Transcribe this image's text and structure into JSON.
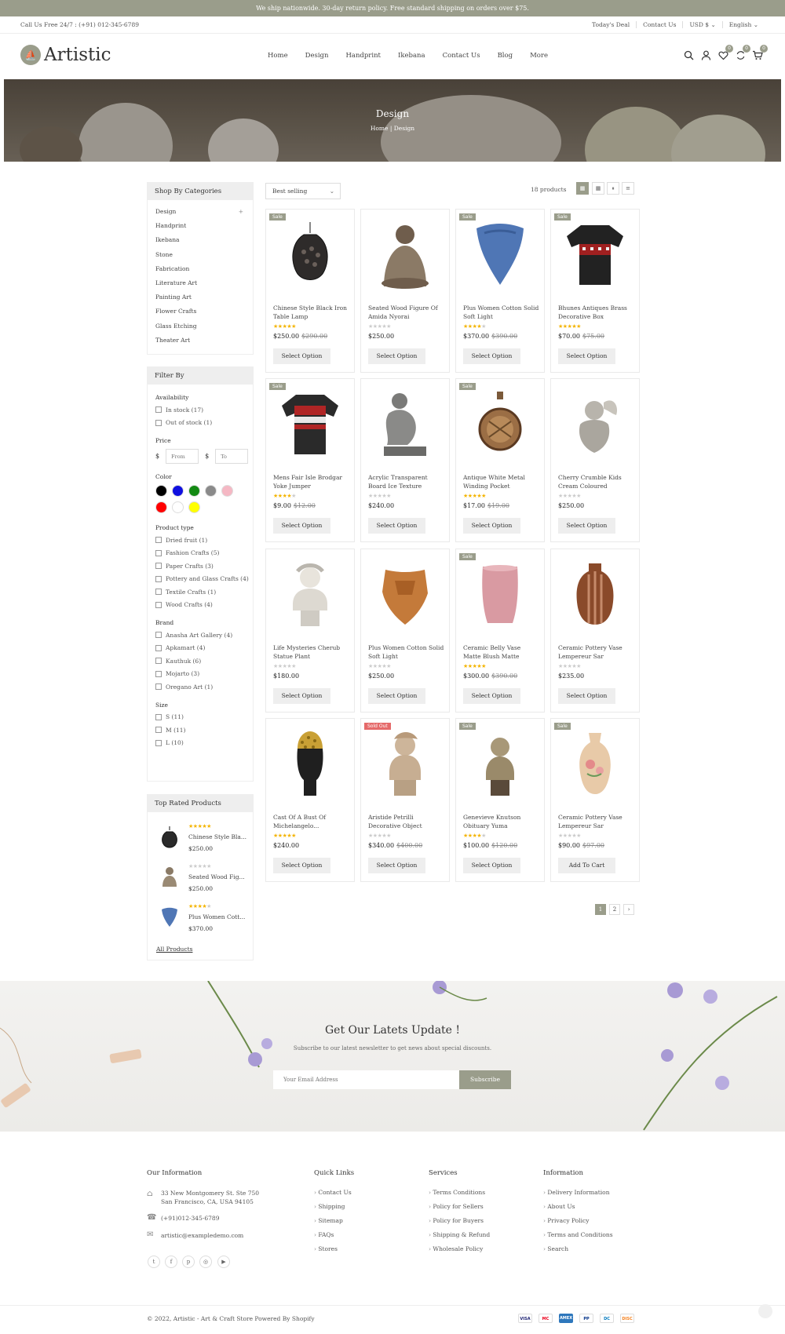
{
  "announcement": "We ship nationwide. 30-day return policy. Free standard shipping on orders over $75.",
  "topbar": {
    "phone": "Call Us Free 24/7 : (+91) 012-345-6789",
    "links": [
      "Today's Deal",
      "Contact Us",
      "USD $ ⌄",
      "English ⌄"
    ]
  },
  "header": {
    "logo": "Artistic",
    "nav": [
      "Home",
      "Design",
      "Handprint",
      "Ikebana",
      "Contact Us",
      "Blog",
      "More"
    ],
    "wishlist_count": "0",
    "compare_count": "0",
    "cart_count": "0"
  },
  "banner": {
    "title": "Design",
    "crumb_home": "Home",
    "crumb_sep": "|",
    "crumb_current": "Design"
  },
  "sidebar": {
    "categories_title": "Shop By Categories",
    "categories": [
      "Design",
      "Handprint",
      "Ikebana",
      "Stone",
      "Fabrication",
      "Literature Art",
      "Painting Art",
      "Flower Crafts",
      "Glass Etching",
      "Theater Art"
    ],
    "filter_title": "Filter By",
    "availability_title": "Availability",
    "availability": [
      "In stock (17)",
      "Out of stock (1)"
    ],
    "price_title": "Price",
    "price_from_placeholder": "From",
    "price_to_placeholder": "To",
    "currency": "$",
    "color_title": "Color",
    "colors": [
      "#000000",
      "#1010e0",
      "#138a13",
      "#8a8a8a",
      "#f5b8c4",
      "#ff0000",
      "#ffffff",
      "#ffff00"
    ],
    "product_type_title": "Product type",
    "product_types": [
      "Dried fruit (1)",
      "Fashion Crafts (5)",
      "Paper Crafts (3)",
      "Pottery and Glass Crafts (4)",
      "Textile Crafts (1)",
      "Wood Crafts (4)"
    ],
    "brand_title": "Brand",
    "brands": [
      "Anasha Art Gallery (4)",
      "Apkamart (4)",
      "Kauthuk (6)",
      "Mojarto (3)",
      "Oregano Art (1)"
    ],
    "size_title": "Size",
    "sizes": [
      "S (11)",
      "M (11)",
      "L (10)"
    ],
    "top_rated_title": "Top Rated Products",
    "top_rated": [
      {
        "name": "Chinese Style Bla...",
        "price": "$250.00",
        "rating": 5
      },
      {
        "name": "Seated Wood Fig...",
        "price": "$250.00",
        "rating": 0
      },
      {
        "name": "Plus Women Cott...",
        "price": "$370.00",
        "rating": 4
      }
    ],
    "all_products": "All Products"
  },
  "toolbar": {
    "sort": "Best selling",
    "count": "18 products"
  },
  "products": [
    {
      "name": "Chinese Style Black Iron Table Lamp",
      "price": "$250.00",
      "old": "$290.00",
      "badge": "Sale",
      "rating": 5,
      "btn": "Select Option"
    },
    {
      "name": "Seated Wood Figure Of Amida Nyorai",
      "price": "$250.00",
      "old": "",
      "badge": "",
      "rating": 0,
      "btn": "Select Option"
    },
    {
      "name": "Plus Women Cotton Solid Soft Light",
      "price": "$370.00",
      "old": "$390.00",
      "badge": "Sale",
      "rating": 4,
      "btn": "Select Option"
    },
    {
      "name": "Bhunes Antiques Brass Decorative Box",
      "price": "$70.00",
      "old": "$75.00",
      "badge": "Sale",
      "rating": 5,
      "btn": "Select Option"
    },
    {
      "name": "Mens Fair Isle Brodgar Yoke Jumper",
      "price": "$9.00",
      "old": "$12.00",
      "badge": "Sale",
      "rating": 4,
      "btn": "Select Option"
    },
    {
      "name": "Acrylic Transparent Board Ice Texture",
      "price": "$240.00",
      "old": "",
      "badge": "",
      "rating": 0,
      "btn": "Select Option"
    },
    {
      "name": "Antique White Metal Winding Pocket",
      "price": "$17.00",
      "old": "$19.00",
      "badge": "Sale",
      "rating": 5,
      "btn": "Select Option"
    },
    {
      "name": "Cherry Crumble Kids Cream Coloured",
      "price": "$250.00",
      "old": "",
      "badge": "",
      "rating": 0,
      "btn": "Select Option"
    },
    {
      "name": "Life Mysteries Cherub Statue Plant",
      "price": "$180.00",
      "old": "",
      "badge": "",
      "rating": 0,
      "btn": "Select Option"
    },
    {
      "name": "Plus Women Cotton Solid Soft Light",
      "price": "$250.00",
      "old": "",
      "badge": "",
      "rating": 0,
      "btn": "Select Option"
    },
    {
      "name": "Ceramic Belly Vase Matte Blush Matte",
      "price": "$300.00",
      "old": "$390.00",
      "badge": "Sale",
      "rating": 5,
      "btn": "Select Option"
    },
    {
      "name": "Ceramic Pottery Vase Lempereur Sar",
      "price": "$235.00",
      "old": "",
      "badge": "",
      "rating": 0,
      "btn": "Select Option"
    },
    {
      "name": "Cast Of A Bust Of Michelangelo...",
      "price": "$240.00",
      "old": "",
      "badge": "",
      "rating": 5,
      "btn": "Select Option"
    },
    {
      "name": "Aristide Petrilli Decorative Object",
      "price": "$340.00",
      "old": "$400.00",
      "badge": "Sold Out",
      "rating": 0,
      "btn": "Select Option"
    },
    {
      "name": "Genevieve Knutson Obituary Yuma",
      "price": "$100.00",
      "old": "$120.00",
      "badge": "Sale",
      "rating": 4,
      "btn": "Select Option"
    },
    {
      "name": "Ceramic Pottery Vase Lempereur Sar",
      "price": "$90.00",
      "old": "$97.00",
      "badge": "Sale",
      "rating": 0,
      "btn": "Add To Cart"
    }
  ],
  "pagination": [
    "1",
    "2",
    "›"
  ],
  "newsletter": {
    "title": "Get Our Latets Update !",
    "subtitle": "Subscribe to our latest newsletter to get news about special discounts.",
    "placeholder": "Your Email Address",
    "button": "Subscribe"
  },
  "footer": {
    "info_title": "Our Information",
    "address": "33 New Montgomery St. Ste 750 San Francisco, CA, USA 94105",
    "phone": "(+91)012-345-6789",
    "email": "artistic@exampledemo.com",
    "quick_title": "Quick Links",
    "quick": [
      "Contact Us",
      "Shipping",
      "Sitemap",
      "FAQs",
      "Stores"
    ],
    "services_title": "Services",
    "services": [
      "Terms Conditions",
      "Policy for Sellers",
      "Policy for Buyers",
      "Shipping & Refund",
      "Wholesale Policy"
    ],
    "information_title": "Information",
    "information": [
      "Delivery Information",
      "About Us",
      "Privacy Policy",
      "Terms and Conditions",
      "Search"
    ],
    "copyright": "© 2022, Artistic - Art & Craft Store Powered By Shopify",
    "payments": [
      "VISA",
      "MC",
      "AMEX",
      "PP",
      "DC",
      "DISC"
    ]
  }
}
